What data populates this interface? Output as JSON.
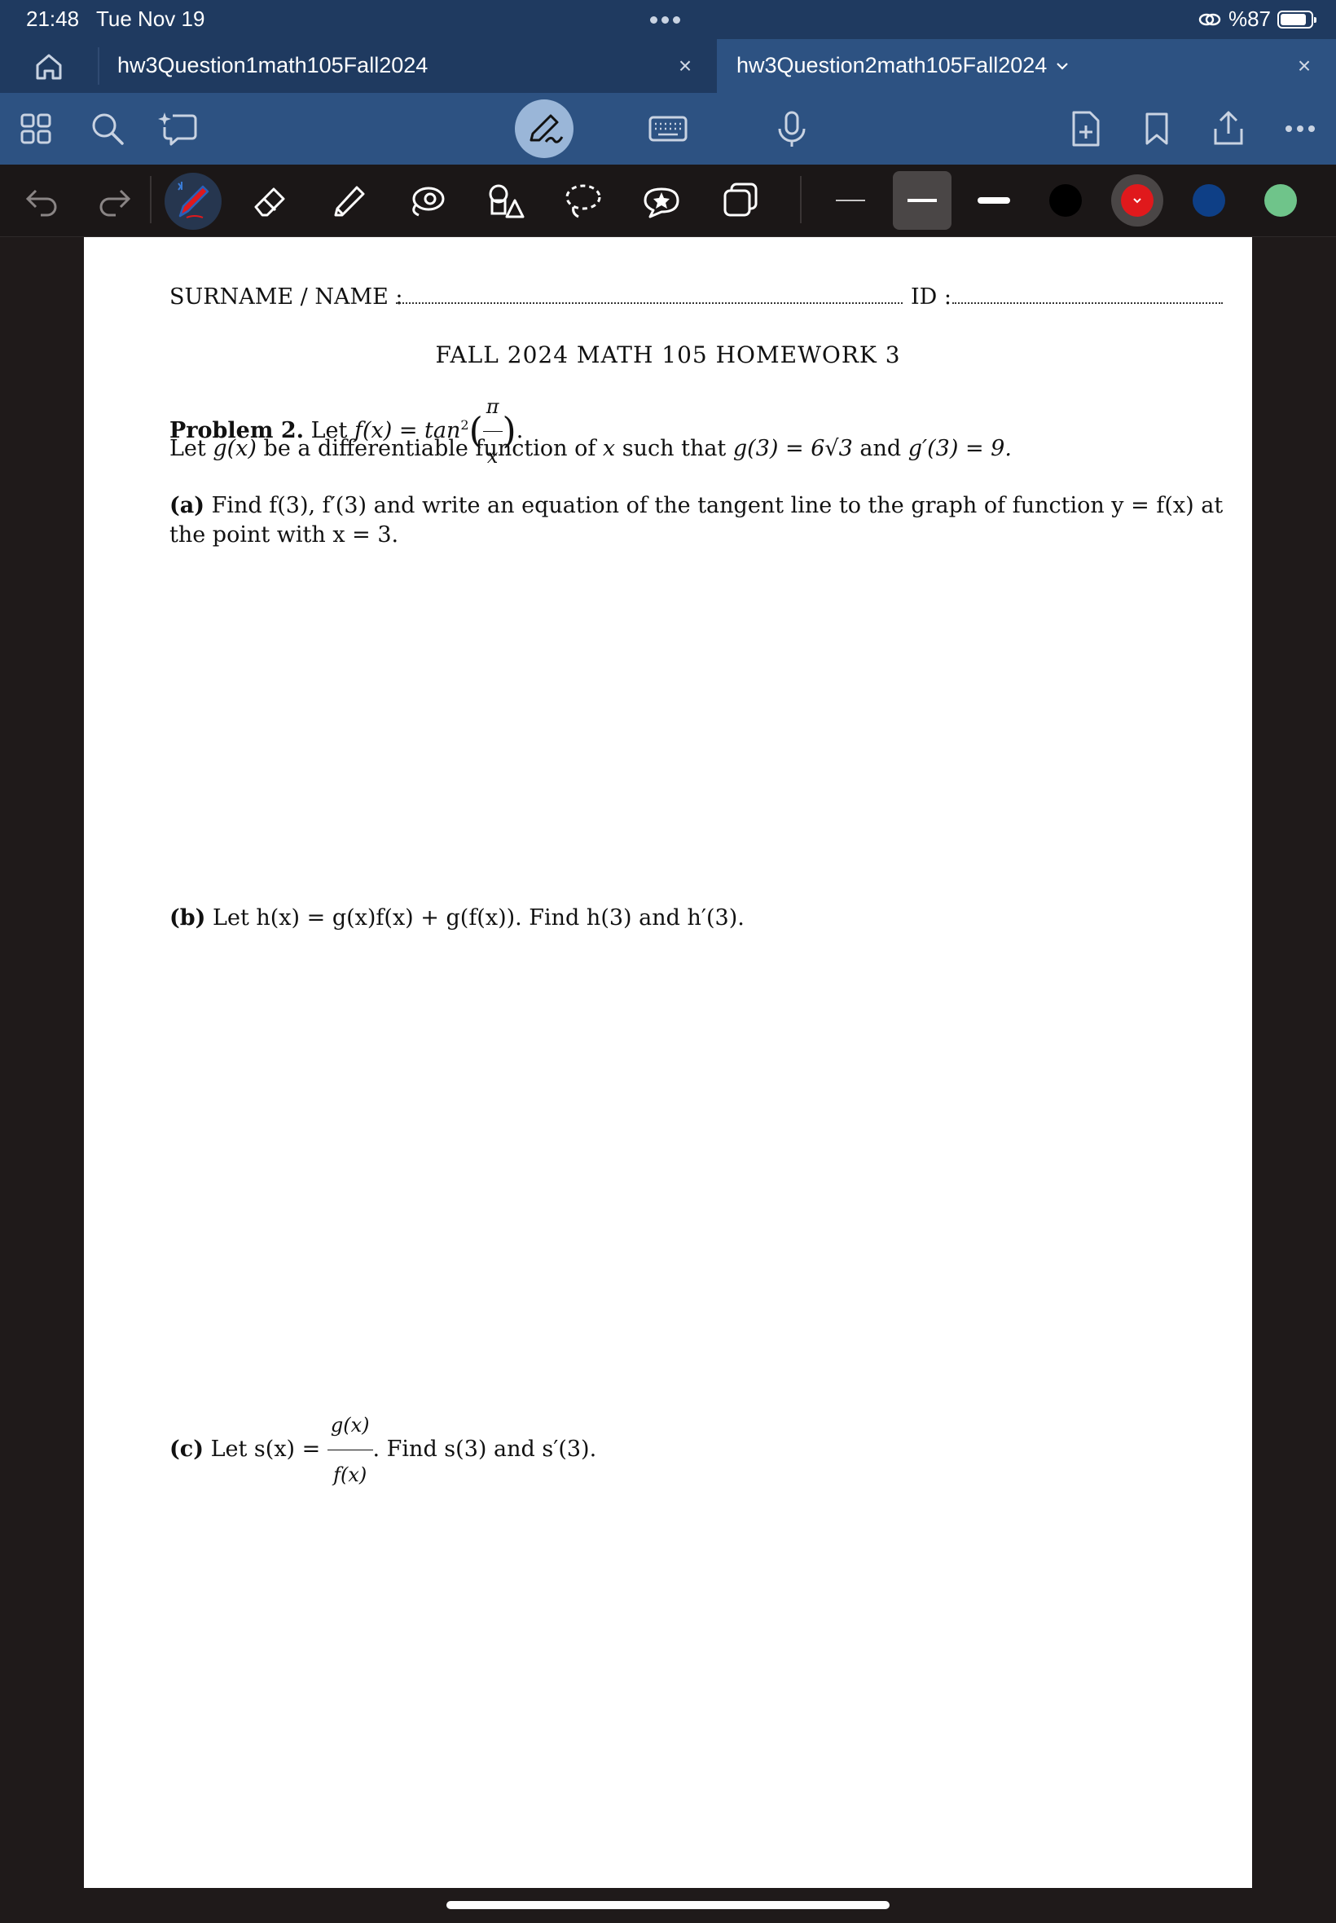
{
  "status_bar": {
    "time": "21:48",
    "date": "Tue Nov 19",
    "battery_text": "%87",
    "battery_level": 0.87
  },
  "tabs": [
    {
      "title": "hw3Question1math105Fall2024",
      "active": false
    },
    {
      "title": "hw3Question2math105Fall2024",
      "active": true
    }
  ],
  "toolbar_icons": [
    "home-icon",
    "grid-icon",
    "search-icon",
    "ai-sparkle-icon",
    "pen-mode-icon",
    "keyboard-icon",
    "microphone-icon",
    "add-page-icon",
    "bookmark-icon",
    "share-icon",
    "more-icon"
  ],
  "drawing_tools": [
    "undo-icon",
    "redo-icon",
    "pen-icon",
    "eraser-icon",
    "highlighter-icon",
    "lasso-shape-icon",
    "shapes-icon",
    "lasso-icon",
    "sticker-icon",
    "image-icon"
  ],
  "colors": {
    "accent": "#2d5282",
    "swatch_black": "#000000",
    "swatch_red": "#e0191c",
    "swatch_blue": "#0e3f86",
    "swatch_green": "#6fc48a"
  },
  "document": {
    "surname_label": "SURNAME / NAME :",
    "id_label": "ID :",
    "title": "FALL 2024 MATH 105 HOMEWORK 3",
    "problem_label": "Problem 2.",
    "problem_let": "Let",
    "f_def_lhs": "f(x) = tan",
    "f_def_exp": "2",
    "pi": "π",
    "x": "x",
    "g_sentence_1": "Let",
    "g_name": "g(x)",
    "g_sentence_2": "be a differentiable function of",
    "g_var": "x",
    "g_sentence_3": "such that",
    "g_cond1": "g(3) = 6√3",
    "g_and": "and",
    "g_cond2": "g′(3) = 9.",
    "part_a_label": "(a)",
    "part_a_text1": "Find f(3), f′(3) and write an equation of the tangent line to the graph of function y = f(x) at",
    "part_a_text2": "the point with x = 3.",
    "part_b_label": "(b)",
    "part_b_text": "Let h(x) = g(x)f(x) + g(f(x)). Find h(3) and h′(3).",
    "part_c_label": "(c)",
    "part_c_let": "Let s(x) =",
    "part_c_num": "g(x)",
    "part_c_den": "f(x)",
    "part_c_rest": ". Find s(3) and s′(3)."
  }
}
